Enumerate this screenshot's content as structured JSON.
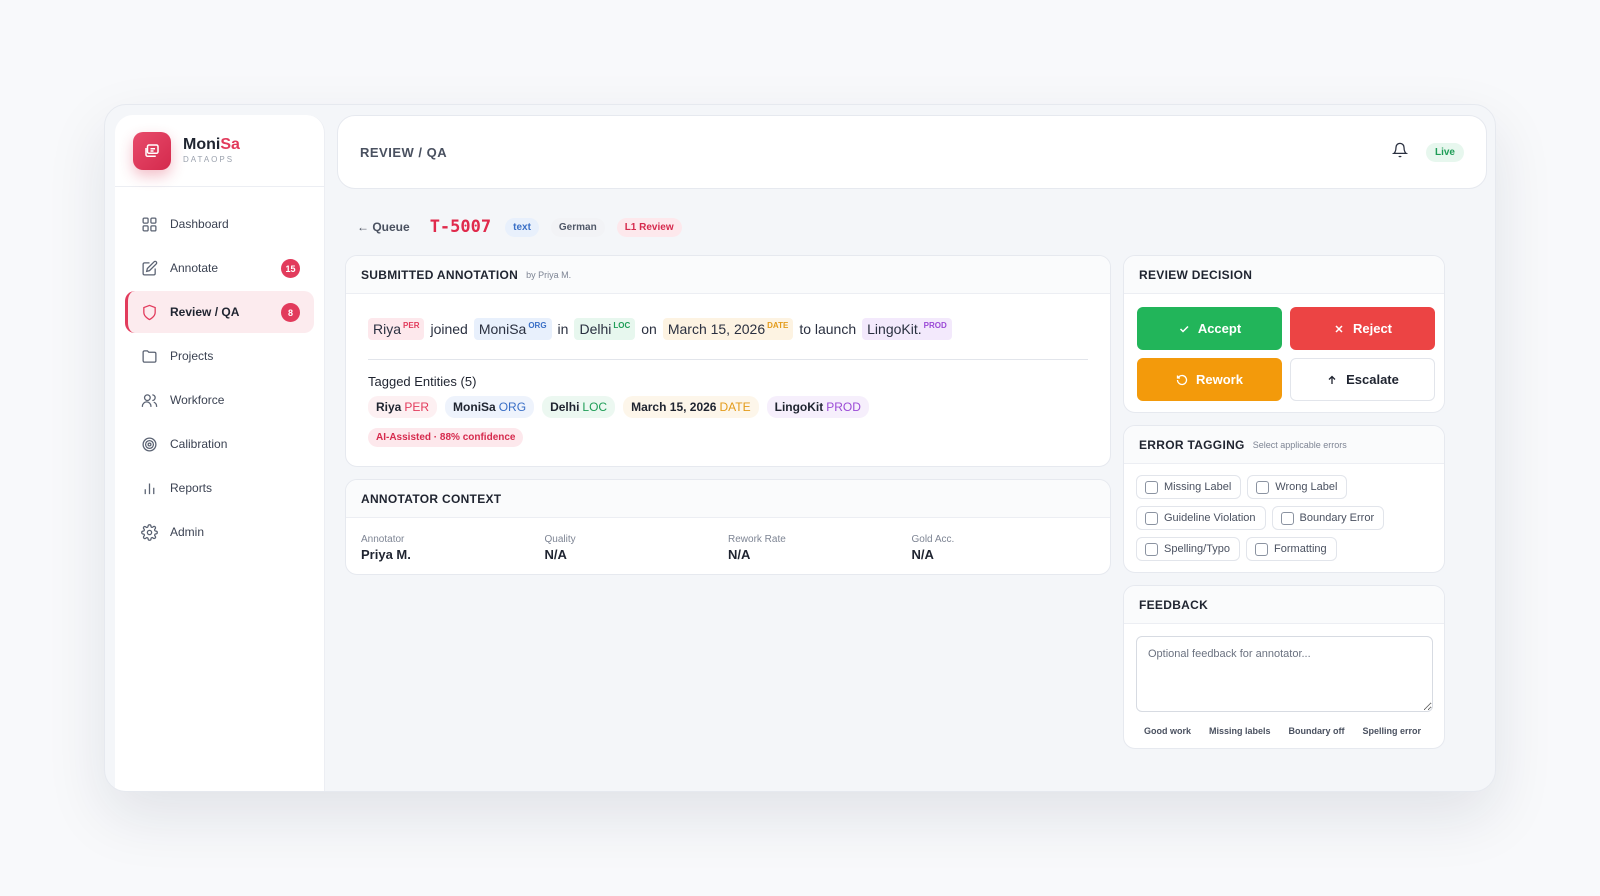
{
  "brand": {
    "name_main": "Moni",
    "name_accent": "Sa",
    "sub": "DATAOPS"
  },
  "nav": {
    "items": [
      {
        "label": "Dashboard",
        "icon": "grid-icon"
      },
      {
        "label": "Annotate",
        "icon": "edit-icon",
        "badge": "15"
      },
      {
        "label": "Review / QA",
        "icon": "shield-icon",
        "badge": "8",
        "active": true
      },
      {
        "label": "Projects",
        "icon": "folder-icon"
      },
      {
        "label": "Workforce",
        "icon": "users-icon"
      },
      {
        "label": "Calibration",
        "icon": "target-icon"
      },
      {
        "label": "Reports",
        "icon": "bar-chart-icon"
      },
      {
        "label": "Admin",
        "icon": "gear-icon"
      }
    ]
  },
  "header": {
    "title": "REVIEW / QA",
    "live": "Live"
  },
  "ticket": {
    "back": "← Queue",
    "id": "T-5007",
    "type": "text",
    "language": "German",
    "stage": "L1 Review"
  },
  "submitted": {
    "title": "SUBMITTED ANNOTATION",
    "by": "by Priya M.",
    "sentence": {
      "e1": "Riya",
      "e1_tag": "PER",
      "w1": "joined",
      "e2": "MoniSa",
      "e2_tag": "ORG",
      "w2": "in",
      "e3": "Delhi",
      "e3_tag": "LOC",
      "w3": "on",
      "e4": "March 15, 2026",
      "e4_tag": "DATE",
      "w4": "to launch",
      "e5": "LingoKit.",
      "e5_tag": "PROD"
    },
    "tagged_title": "Tagged Entities (5)",
    "tags": [
      {
        "text": "Riya",
        "type": "PER"
      },
      {
        "text": "MoniSa",
        "type": "ORG"
      },
      {
        "text": "Delhi",
        "type": "LOC"
      },
      {
        "text": "March 15, 2026",
        "type": "DATE"
      },
      {
        "text": "LingoKit",
        "type": "PROD"
      }
    ],
    "ai_note": "AI-Assisted · 88% confidence"
  },
  "context": {
    "title": "ANNOTATOR CONTEXT",
    "fields": [
      {
        "label": "Annotator",
        "value": "Priya M."
      },
      {
        "label": "Quality",
        "value": "N/A"
      },
      {
        "label": "Rework Rate",
        "value": "N/A"
      },
      {
        "label": "Gold Acc.",
        "value": "N/A"
      }
    ]
  },
  "decision": {
    "title": "REVIEW DECISION",
    "accept": "Accept",
    "reject": "Reject",
    "rework": "Rework",
    "escalate": "Escalate"
  },
  "errors": {
    "title": "ERROR TAGGING",
    "sub": "Select applicable errors",
    "items": [
      "Missing Label",
      "Wrong Label",
      "Guideline Violation",
      "Boundary Error",
      "Spelling/Typo",
      "Formatting"
    ]
  },
  "feedback": {
    "title": "FEEDBACK",
    "placeholder": "Optional feedback for annotator...",
    "quick": [
      "Good work",
      "Missing labels",
      "Boundary off",
      "Spelling error"
    ]
  },
  "colors": {
    "brand": "#e23b5c",
    "accept": "#22b55a",
    "reject": "#ec4444",
    "rework": "#f39a0b"
  }
}
